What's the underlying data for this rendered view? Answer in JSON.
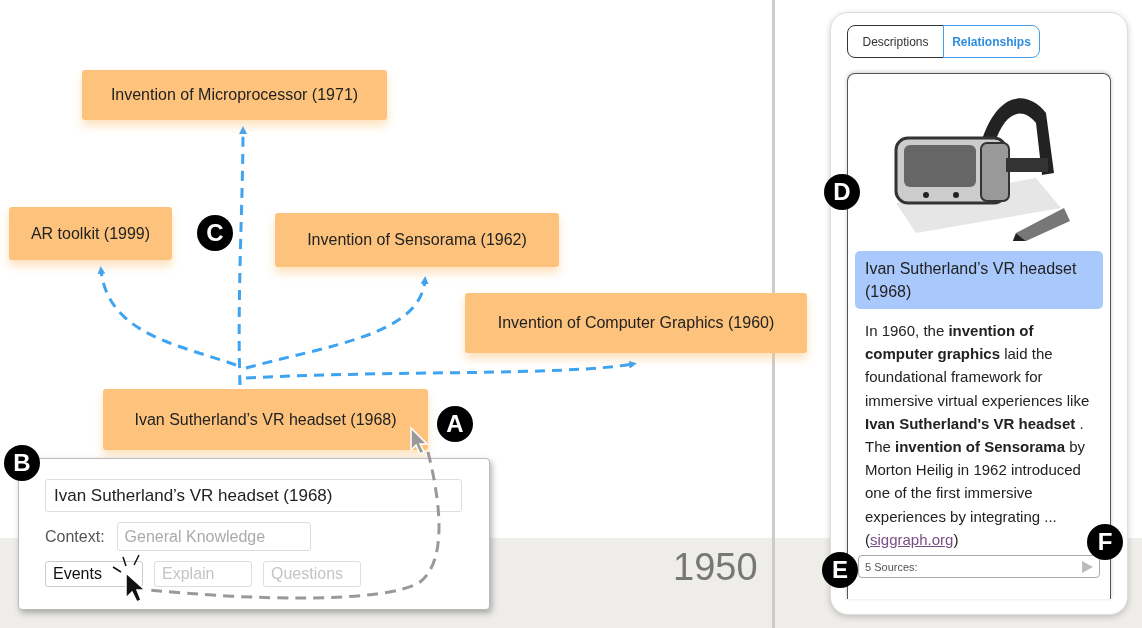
{
  "nodes": [
    {
      "label": "Invention of Microprocessor (1971)"
    },
    {
      "label": "AR toolkit (1999)"
    },
    {
      "label": "Invention of Sensorama (1962)"
    },
    {
      "label": "Invention of Computer Graphics (1960)"
    },
    {
      "label": "Ivan Sutherland’s VR headset (1968)"
    }
  ],
  "timeline": {
    "year_label": "1950"
  },
  "popup": {
    "title_value": "Ivan Sutherland’s VR headset (1968)",
    "context_label": "Context:",
    "context_placeholder": "General Knowledge",
    "buttons": [
      {
        "label": "Events",
        "disabled": false
      },
      {
        "label": "Explain",
        "disabled": true
      },
      {
        "label": "Questions",
        "disabled": true
      }
    ]
  },
  "panel": {
    "tabs": [
      {
        "label": "Descriptions",
        "selected": false
      },
      {
        "label": "Relationships",
        "selected": true
      }
    ],
    "card": {
      "kind": "picture",
      "title": "Ivan Sutherland’s VR headset (1968)",
      "text": "In 1960, the **invention of computer graphics** laid the foundational framework for immersive virtual experiences like **Ivan Sutherland's VR headset** . The **invention of Sensorama** by Morton Heilig in 1962 introduced one of the first immersive experiences by integrating ... (",
      "link": "siggraph.org",
      "text_after": ")",
      "sources": "5 Sources:"
    }
  },
  "markers": [
    {
      "letter": "A"
    },
    {
      "letter": "B"
    },
    {
      "letter": "C"
    },
    {
      "letter": "D"
    },
    {
      "letter": "E"
    },
    {
      "letter": "F"
    }
  ]
}
